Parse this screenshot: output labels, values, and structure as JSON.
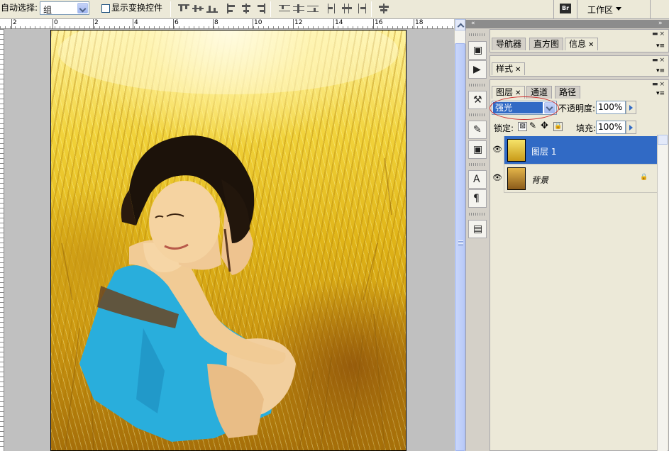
{
  "options_bar": {
    "auto_select_label": "自动选择:",
    "auto_select_value": "组",
    "show_transform_label": "显示变换控件",
    "workspace_label": "工作区"
  },
  "ruler": {
    "h_labels": [
      "2",
      "0",
      "2",
      "4",
      "6",
      "8",
      "10",
      "12",
      "14",
      "16",
      "18"
    ]
  },
  "panels": {
    "top_tabs": [
      "导航器",
      "直方图",
      "信息"
    ],
    "style_tabs": [
      "样式"
    ],
    "layer_tabs": [
      "图层",
      "通道",
      "路径"
    ]
  },
  "layers": {
    "blend_mode": "强光",
    "opacity_label": "不透明度:",
    "opacity_value": "100%",
    "lock_label": "锁定:",
    "fill_label": "填充:",
    "fill_value": "100%",
    "items": [
      {
        "name": "图层 1",
        "selected": true
      },
      {
        "name": "背景",
        "selected": false,
        "locked": true
      }
    ]
  },
  "colors": {
    "selection": "#316ac5",
    "panel_bg": "#ece9d8",
    "highlight_circle": "#d03030"
  }
}
